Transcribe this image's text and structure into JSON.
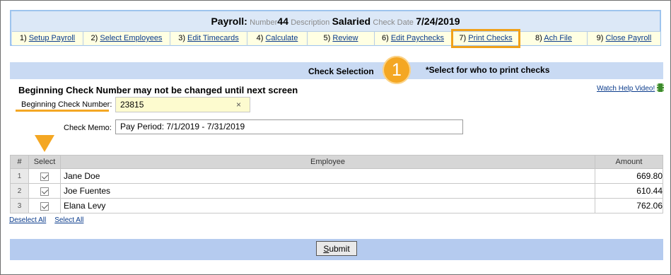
{
  "header": {
    "title": "Payroll:",
    "number_label": "Number",
    "number": "44",
    "description_label": "Description",
    "description": "Salaried",
    "check_date_label": "Check Date",
    "check_date": "7/24/2019"
  },
  "steps": [
    {
      "num": "1)",
      "label": "Setup Payroll"
    },
    {
      "num": "2)",
      "label": "Select Employees"
    },
    {
      "num": "3)",
      "label": "Edit Timecards"
    },
    {
      "num": "4)",
      "label": "Calculate"
    },
    {
      "num": "5)",
      "label": "Review"
    },
    {
      "num": "6)",
      "label": "Edit Paychecks"
    },
    {
      "num": "7)",
      "label": "Print Checks"
    },
    {
      "num": "8)",
      "label": "Ach File"
    },
    {
      "num": "9)",
      "label": "Close Payroll"
    }
  ],
  "section": {
    "title": "Check Selection",
    "badge": "1",
    "note": "*Select for who to print checks",
    "warning": "Beginning Check Number may not be changed until next screen",
    "help_link": "Watch Help Video!"
  },
  "form": {
    "check_number_label": "Beginning Check Number:",
    "check_number": "23815",
    "clear_symbol": "×",
    "memo_label": "Check Memo:",
    "memo": "Pay Period: 7/1/2019 - 7/31/2019"
  },
  "table": {
    "headers": {
      "idx": "#",
      "select": "Select",
      "employee": "Employee",
      "amount": "Amount"
    },
    "rows": [
      {
        "idx": "1",
        "employee": "Jane Doe",
        "amount": "669.80"
      },
      {
        "idx": "2",
        "employee": "Joe Fuentes",
        "amount": "610.44"
      },
      {
        "idx": "3",
        "employee": "Elana Levy",
        "amount": "762.06"
      }
    ]
  },
  "links": {
    "deselect_all": "Deselect All",
    "select_all": "Select All"
  },
  "submit": {
    "underlined_letter": "S",
    "rest": "ubmit"
  },
  "colors": {
    "accent": "#f4a723",
    "header_bg": "#dce8f7",
    "steps_bg": "#ffffe3",
    "bar_bg": "#c9daf3",
    "link": "#0b3c8c"
  }
}
